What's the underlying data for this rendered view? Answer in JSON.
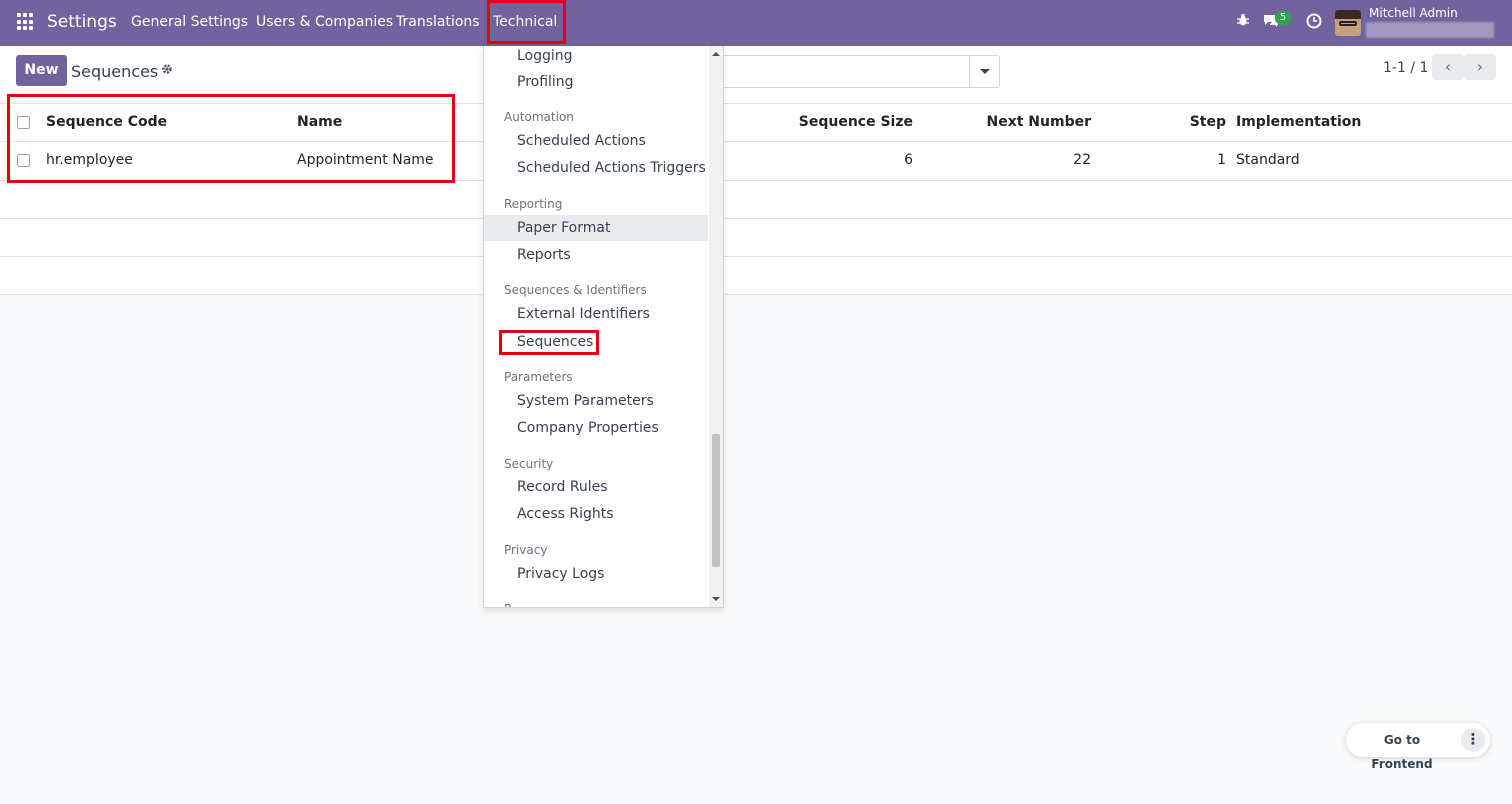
{
  "navbar": {
    "brand": "Settings",
    "menu": [
      "General Settings",
      "Users & Companies",
      "Translations",
      "Technical"
    ],
    "message_count": "5",
    "user_name": "Mitchell Admin"
  },
  "control_panel": {
    "new_label": "New",
    "title": "Sequences",
    "pager": "1-1 / 1"
  },
  "table": {
    "columns": [
      "Sequence Code",
      "Name",
      "Sequence Size",
      "Next Number",
      "Step",
      "Implementation"
    ],
    "rows": [
      [
        "hr.employee",
        "Appointment Name",
        "6",
        "22",
        "1",
        "Standard"
      ]
    ]
  },
  "dropdown": {
    "items": {
      "logging": "Logging",
      "profiling": "Profiling",
      "scheduled_actions": "Scheduled Actions",
      "scheduled_actions_triggers": "Scheduled Actions Triggers",
      "paper_format": "Paper Format",
      "reports": "Reports",
      "external_identifiers": "External Identifiers",
      "sequences": "Sequences",
      "system_parameters": "System Parameters",
      "company_properties": "Company Properties",
      "record_rules": "Record Rules",
      "access_rights": "Access Rights",
      "privacy_logs": "Privacy Logs"
    },
    "sections": {
      "automation": "Automation",
      "reporting": "Reporting",
      "sequences_identifiers": "Sequences & Identifiers",
      "parameters": "Parameters",
      "security": "Security",
      "privacy": "Privacy",
      "partial": "P"
    }
  },
  "frontend": {
    "label": "Go to Frontend"
  },
  "colors": {
    "brand": "#71639e",
    "highlight": "#e3000f"
  }
}
